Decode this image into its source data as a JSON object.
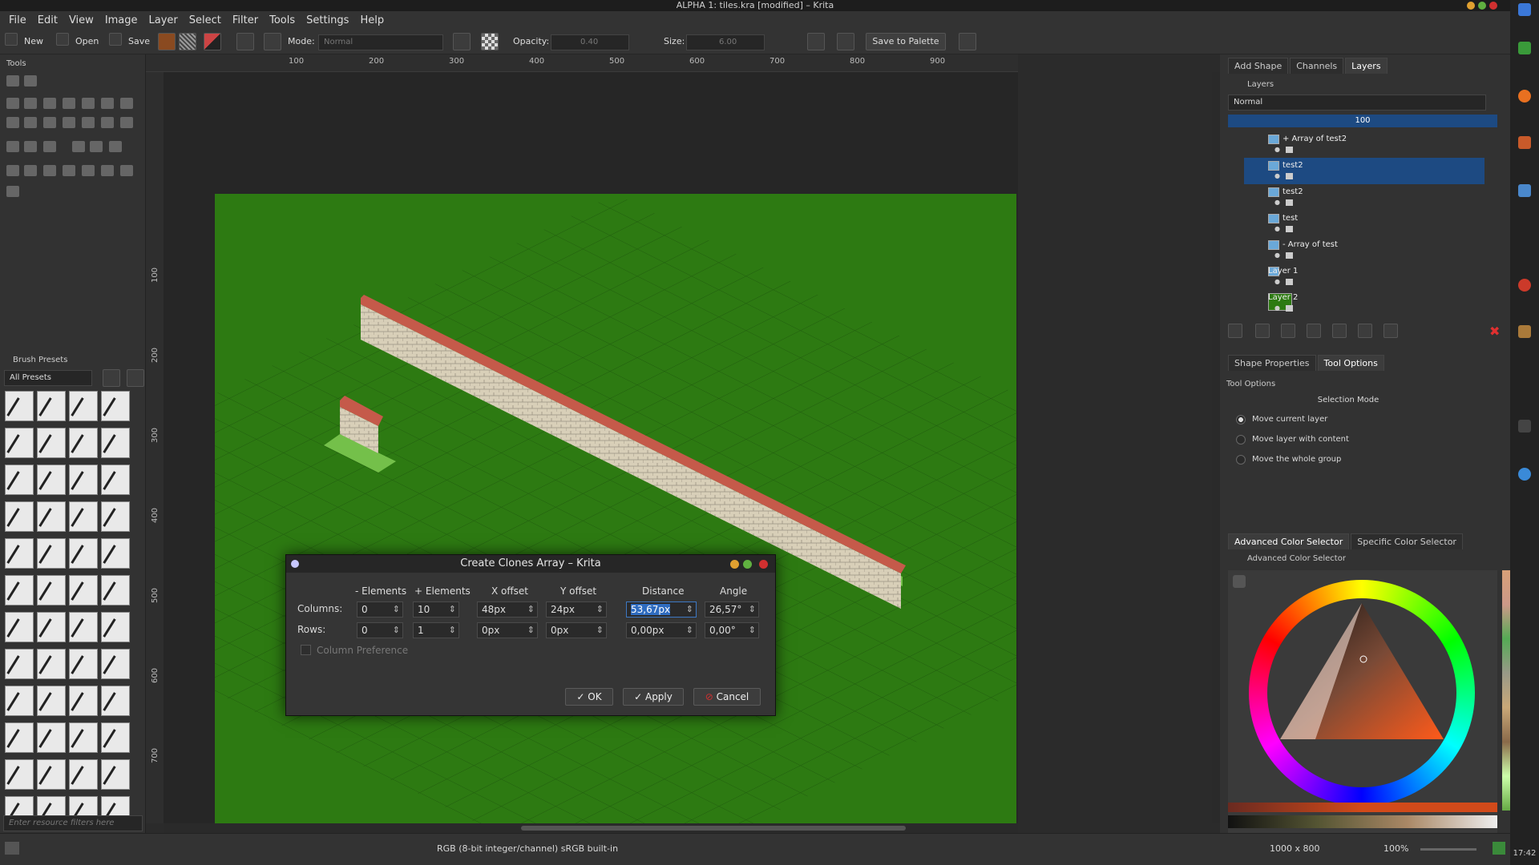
{
  "window": {
    "title": "ALPHA 1: tiles.kra [modified] – Krita",
    "clock": "17:42"
  },
  "menu": [
    "File",
    "Edit",
    "View",
    "Image",
    "Layer",
    "Select",
    "Filter",
    "Tools",
    "Settings",
    "Help"
  ],
  "toolbar": {
    "new_label": "New",
    "open_label": "Open",
    "save_label": "Save",
    "mode_label": "Mode:",
    "mode_value": "Normal",
    "opacity_label": "Opacity:",
    "opacity_value": "0.40",
    "size_label": "Size:",
    "size_value": "6.00",
    "save_palette_label": "Save to Palette"
  },
  "left_dock": {
    "tools_title": "Tools",
    "brush_presets_title": "Brush Presets",
    "presets_filter": "All Presets",
    "resource_filter_placeholder": "Enter resource filters here"
  },
  "ruler": {
    "top_ticks": [
      "100",
      "200",
      "300",
      "400",
      "500",
      "600",
      "700",
      "800",
      "900"
    ],
    "left_ticks": [
      "100",
      "200",
      "300",
      "400",
      "500",
      "600",
      "700"
    ]
  },
  "right_dock": {
    "top_tabs": [
      "Add Shape",
      "Channels",
      "Layers"
    ],
    "layers_title": "Layers",
    "blend_mode": "Normal",
    "opacity": "100",
    "layers": [
      {
        "name": "+ Array of test2"
      },
      {
        "name": "test2"
      },
      {
        "name": "test2"
      },
      {
        "name": "test"
      },
      {
        "name": "- Array of test"
      },
      {
        "name": "Layer 1"
      },
      {
        "name": "Layer 2"
      }
    ],
    "mid_tabs": [
      "Shape Properties",
      "Tool Options"
    ],
    "tool_options_title": "Tool Options",
    "selection_mode_title": "Selection Mode",
    "selection_modes": [
      "Move current layer",
      "Move layer with content",
      "Move the whole group"
    ],
    "color_tabs": [
      "Advanced Color Selector",
      "Specific Color Selector"
    ],
    "color_selector_title": "Advanced Color Selector"
  },
  "dialog": {
    "title": "Create Clones Array – Krita",
    "headers": [
      "- Elements",
      "+ Elements",
      "X offset",
      "Y offset",
      "Distance",
      "Angle"
    ],
    "columns_label": "Columns:",
    "rows_label": "Rows:",
    "columns": [
      "0",
      "10",
      "48px",
      "24px",
      "53,67px",
      "26,57°"
    ],
    "rows": [
      "0",
      "1",
      "0px",
      "0px",
      "0,00px",
      "0,00°"
    ],
    "column_preference_label": "Column Preference",
    "ok_label": "OK",
    "apply_label": "Apply",
    "cancel_label": "Cancel"
  },
  "status": {
    "color_space": "RGB (8-bit integer/channel)  sRGB built-in",
    "image_size": "1000 x 800",
    "zoom": "100%"
  },
  "colors": {
    "canvas_green": "#2d7a12",
    "selection_blue": "#1d4a82",
    "accent_blue": "#3d78c2"
  }
}
